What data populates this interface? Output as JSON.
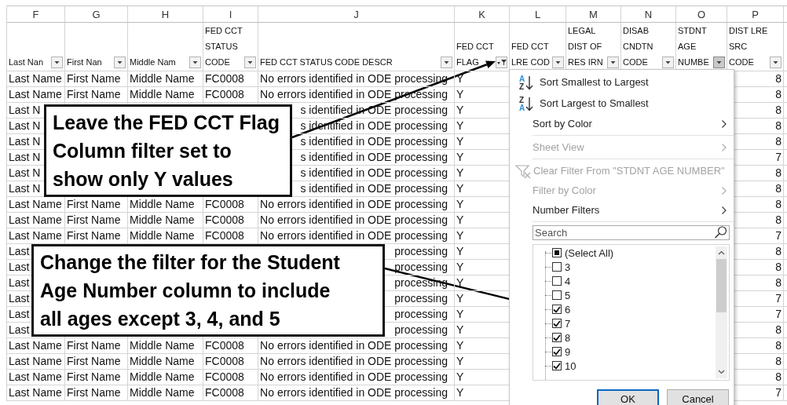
{
  "sheet": {
    "columns": [
      {
        "letter": "F",
        "header": "Last Nan",
        "filtered": false,
        "open": false
      },
      {
        "letter": "G",
        "header": "First Nan",
        "filtered": false,
        "open": false
      },
      {
        "letter": "H",
        "header": "Middle Nam",
        "filtered": false,
        "open": false
      },
      {
        "letter": "I",
        "header": "FED CCT\nSTATUS\nCODE",
        "filtered": false,
        "open": false
      },
      {
        "letter": "J",
        "header": "FED CCT STATUS CODE DESCR",
        "filtered": false,
        "open": false
      },
      {
        "letter": "K",
        "header": "FED CCT\nFLAG",
        "filtered": true,
        "open": false
      },
      {
        "letter": "L",
        "header": "FED CCT\nLRE COD",
        "filtered": false,
        "open": false
      },
      {
        "letter": "M",
        "header": "LEGAL\nDIST OF\nRES IRN",
        "filtered": false,
        "open": false
      },
      {
        "letter": "N",
        "header": "DISAB\nCNDTN\nCODE",
        "filtered": false,
        "open": false
      },
      {
        "letter": "O",
        "header": "STDNT\nAGE\nNUMBE",
        "filtered": false,
        "open": true
      },
      {
        "letter": "P",
        "header": "DIST LRE\nSRC\nCODE",
        "filtered": false,
        "open": false
      }
    ],
    "rows": [
      {
        "last_name": "Last Name",
        "first_name": "First Name",
        "middle_name": "Middle Name",
        "status_code": "FC0008",
        "status_descr": "No errors identified in ODE processing",
        "flag": "Y",
        "dist_lre_src_code": "8"
      },
      {
        "last_name": "Last Name",
        "first_name": "First Name",
        "middle_name": "Middle Name",
        "status_code": "FC0008",
        "status_descr": "No errors identified in ODE processing",
        "flag": "Y",
        "dist_lre_src_code": "8"
      },
      {
        "last_name": "Last N",
        "status_descr": "s identified in ODE processing",
        "flag": "Y",
        "dist_lre_src_code": "8"
      },
      {
        "last_name": "Last N",
        "status_descr": "s identified in ODE processing",
        "flag": "Y",
        "dist_lre_src_code": "8"
      },
      {
        "last_name": "Last N",
        "status_descr": "s identified in ODE processing",
        "flag": "Y",
        "dist_lre_src_code": "8"
      },
      {
        "last_name": "Last N",
        "status_descr": "s identified in ODE processing",
        "flag": "Y",
        "dist_lre_src_code": "7"
      },
      {
        "last_name": "Last N",
        "status_descr": "s identified in ODE processing",
        "flag": "Y",
        "dist_lre_src_code": "8"
      },
      {
        "last_name": "Last N",
        "status_descr": "s identified in ODE processing",
        "flag": "Y",
        "dist_lre_src_code": "8"
      },
      {
        "last_name": "Last Name",
        "first_name": "First Name",
        "middle_name": "Middle Name",
        "status_code": "FC0008",
        "status_descr": "No errors identified in ODE processing",
        "flag": "Y",
        "dist_lre_src_code": "8"
      },
      {
        "last_name": "Last Name",
        "first_name": "First Name",
        "middle_name": "Middle Name",
        "status_code": "FC0008",
        "status_descr": "No errors identified in ODE processing",
        "flag": "Y",
        "dist_lre_src_code": "8"
      },
      {
        "last_name": "Last Name",
        "first_name": "First Name",
        "middle_name": "Middle Name",
        "status_code": "FC0008",
        "status_descr": "No errors identified in ODE processing",
        "flag": "Y",
        "dist_lre_src_code": "7"
      },
      {
        "last_name": "Last",
        "status_descr": "processing",
        "flag": "Y",
        "dist_lre_src_code": "8"
      },
      {
        "last_name": "Last",
        "status_descr": "processing",
        "flag": "Y",
        "dist_lre_src_code": "8"
      },
      {
        "last_name": "Last",
        "status_descr": "processing",
        "flag": "Y",
        "dist_lre_src_code": "8"
      },
      {
        "last_name": "Last",
        "status_descr": "processing",
        "flag": "Y",
        "dist_lre_src_code": "7"
      },
      {
        "last_name": "Last",
        "status_descr": "processing",
        "flag": "Y",
        "dist_lre_src_code": "7"
      },
      {
        "last_name": "Last",
        "status_descr": "processing",
        "flag": "Y",
        "dist_lre_src_code": "8"
      },
      {
        "last_name": "Last Name",
        "first_name": "First Name",
        "middle_name": "Middle Name",
        "status_code": "FC0008",
        "status_descr": "No errors identified in ODE processing",
        "flag": "Y",
        "dist_lre_src_code": "8"
      },
      {
        "last_name": "Last Name",
        "first_name": "First Name",
        "middle_name": "Middle Name",
        "status_code": "FC0008",
        "status_descr": "No errors identified in ODE processing",
        "flag": "Y",
        "dist_lre_src_code": "8"
      },
      {
        "last_name": "Last Name",
        "first_name": "First Name",
        "middle_name": "Middle Name",
        "status_code": "FC0008",
        "status_descr": "No errors identified in ODE processing",
        "flag": "Y",
        "dist_lre_src_code": "8"
      },
      {
        "last_name": "Last Name",
        "first_name": "First Name",
        "middle_name": "Middle Name",
        "status_code": "FC0008",
        "status_descr": "No errors identified in ODE processing",
        "flag": "Y",
        "dist_lre_src_code": "7"
      }
    ]
  },
  "filter_menu": {
    "items": [
      {
        "kind": "sort-ascending",
        "label": "Sort Smallest to Largest",
        "icon_letters": [
          "A",
          "Z"
        ],
        "submenu": false,
        "disabled": false
      },
      {
        "kind": "sort-descending",
        "label": "Sort Largest to Smallest",
        "icon_letters": [
          "Z",
          "A"
        ],
        "submenu": false,
        "disabled": false
      },
      {
        "kind": "plain",
        "label": "Sort by Color",
        "submenu": true,
        "disabled": false
      },
      {
        "kind": "separator"
      },
      {
        "kind": "plain",
        "label": "Sheet View",
        "submenu": true,
        "disabled": true
      },
      {
        "kind": "separator"
      },
      {
        "kind": "clear-filter",
        "label": "Clear Filter From \"STDNT AGE NUMBER\"",
        "submenu": false,
        "disabled": true
      },
      {
        "kind": "plain",
        "label": "Filter by Color",
        "submenu": true,
        "disabled": true
      },
      {
        "kind": "plain",
        "label": "Number Filters",
        "submenu": true,
        "disabled": false
      },
      {
        "kind": "separator"
      }
    ],
    "search": {
      "placeholder": "Search"
    },
    "select_all": {
      "label": "(Select All)",
      "checked": false,
      "mixed": true
    },
    "values": [
      {
        "label": "3",
        "checked": false
      },
      {
        "label": "4",
        "checked": false
      },
      {
        "label": "5",
        "checked": false
      },
      {
        "label": "6",
        "checked": true
      },
      {
        "label": "7",
        "checked": true
      },
      {
        "label": "8",
        "checked": true
      },
      {
        "label": "9",
        "checked": true
      },
      {
        "label": "10",
        "checked": true
      }
    ],
    "buttons": [
      {
        "label": "OK",
        "default": true
      },
      {
        "label": "Cancel",
        "default": false
      }
    ]
  },
  "callouts": [
    {
      "text": "Leave the FED CCT Flag\nColumn filter set to\nshow only Y values"
    },
    {
      "text": "Change the filter for the Student\nAge Number column to include\nall ages except 3, 4, and 5"
    }
  ]
}
